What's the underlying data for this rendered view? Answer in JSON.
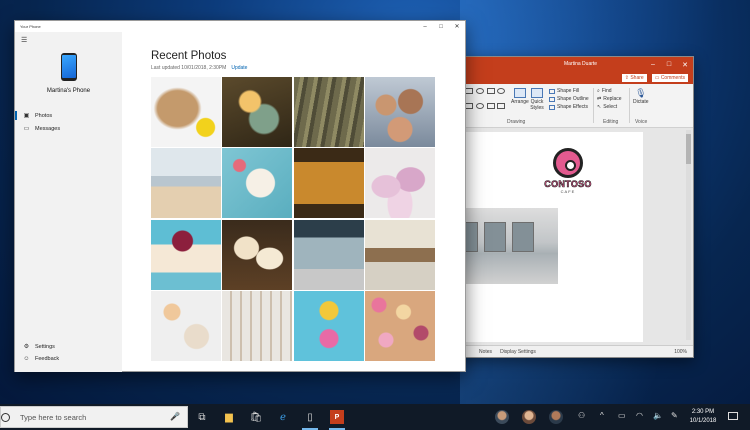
{
  "phone_app": {
    "window_title": "Your Phone",
    "phone_name": "Martina's Phone",
    "nav": [
      {
        "label": "Photos",
        "icon": "photos-icon",
        "active": true
      },
      {
        "label": "Messages",
        "icon": "messages-icon",
        "active": false
      }
    ],
    "bottom_nav": [
      {
        "label": "Settings",
        "icon": "gear-icon"
      },
      {
        "label": "Feedback",
        "icon": "feedback-icon"
      }
    ],
    "heading": "Recent Photos",
    "last_updated": "Last updated 10/01/2018, 2:30PM",
    "update_link": "Update",
    "photos": [
      {
        "subject": "dog-with-ball"
      },
      {
        "subject": "succulents"
      },
      {
        "subject": "tree-bark"
      },
      {
        "subject": "family-selfie"
      },
      {
        "subject": "beach-family"
      },
      {
        "subject": "baking-flatlay"
      },
      {
        "subject": "bakery-sign"
      },
      {
        "subject": "pink-macarons"
      },
      {
        "subject": "berry-cheesecake"
      },
      {
        "subject": "cupcakes"
      },
      {
        "subject": "cafe-storefront"
      },
      {
        "subject": "cafe-interior"
      },
      {
        "subject": "eggs-and-bowls"
      },
      {
        "subject": "baking-utensils"
      },
      {
        "subject": "donuts-on-blue"
      },
      {
        "subject": "donut-box"
      }
    ]
  },
  "powerpoint": {
    "user": "Martina Duarte",
    "share": "Share",
    "comments": "Comments",
    "ribbon": {
      "arrange": "Arrange",
      "quick_styles": "Quick Styles",
      "shape_fill": "Shape Fill",
      "shape_outline": "Shape Outline",
      "shape_effects": "Shape Effects",
      "find": "Find",
      "replace": "Replace",
      "select": "Select",
      "dictate": "Dictate",
      "group_drawing": "Drawing",
      "group_editing": "Editing",
      "group_voice": "Voice"
    },
    "logo_text": "CONTOSO",
    "logo_sub": "CAFE",
    "status": {
      "notes": "Notes",
      "display_settings": "Display Settings",
      "zoom": "100%"
    }
  },
  "taskbar": {
    "search_placeholder": "Type here to search",
    "time": "2:30 PM",
    "date": "10/1/2018"
  },
  "colors": {
    "accent": "#0063b1",
    "ppt_red": "#c43e1c",
    "taskbar": "#101a27"
  }
}
